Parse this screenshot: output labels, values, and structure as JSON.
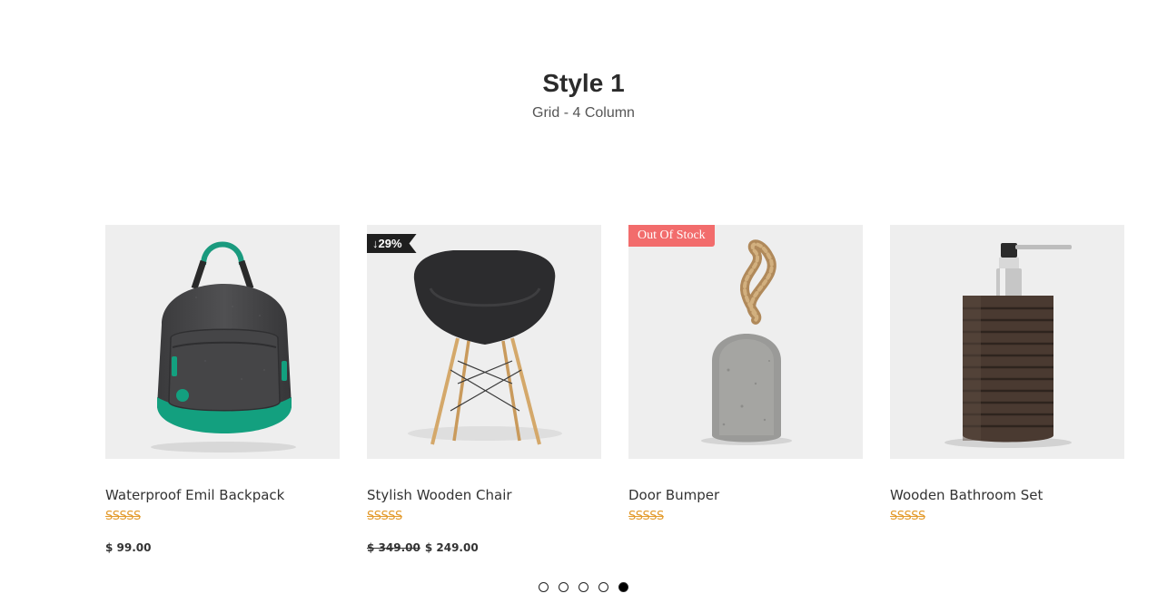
{
  "header": {
    "title": "Style 1",
    "subtitle": "Grid - 4 Column"
  },
  "products": [
    {
      "name": "Waterproof Emil Backpack",
      "rating_text": "SSSSS",
      "price": "$ 99.00",
      "old_price": "",
      "badge": ""
    },
    {
      "name": "Stylish Wooden Chair",
      "rating_text": "SSSSS",
      "price": "$ 249.00",
      "old_price": "$ 349.00",
      "badge": "↓29%"
    },
    {
      "name": "Door Bumper",
      "rating_text": "SSSSS",
      "price": "",
      "old_price": "",
      "badge": "Out Of Stock"
    },
    {
      "name": "Wooden Bathroom Set",
      "rating_text": "SSSSS",
      "price": "",
      "old_price": "",
      "badge": ""
    }
  ],
  "pagination": {
    "count": 5,
    "active_index": 4
  },
  "colors": {
    "rating": "#e39a2b",
    "out_of_stock_badge": "#f26c6c",
    "discount_badge": "#1f1f1f",
    "thumb_bg": "#eeeeee"
  }
}
